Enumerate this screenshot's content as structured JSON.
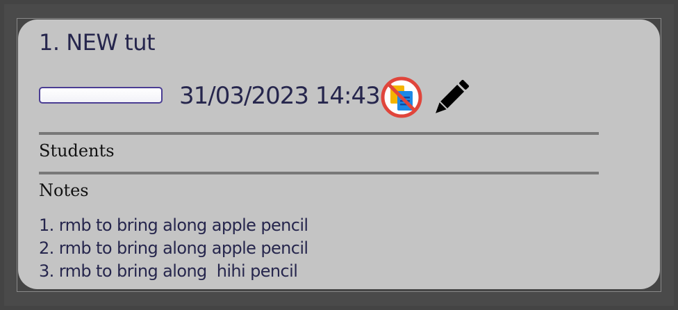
{
  "card": {
    "title": "1.  NEW tut",
    "progress": 0,
    "datetime": "31/03/2023 14:43",
    "icons": {
      "no_copy": "no-copy-icon",
      "edit": "pencil-icon"
    },
    "students_label": "Students",
    "notes_label": "Notes",
    "notes": [
      "1. rmb to bring along apple pencil",
      "2. rmb to bring along apple pencil",
      "3. rmb to bring along  hihi pencil"
    ]
  },
  "colors": {
    "background": "#3c3c3c",
    "card": "#c4c4c4",
    "text_primary": "#26264d",
    "progress_border": "#4a3d93",
    "divider": "#787878",
    "icon_red": "#e0453b",
    "icon_blue": "#1e88e5",
    "icon_yellow": "#f4b400"
  }
}
